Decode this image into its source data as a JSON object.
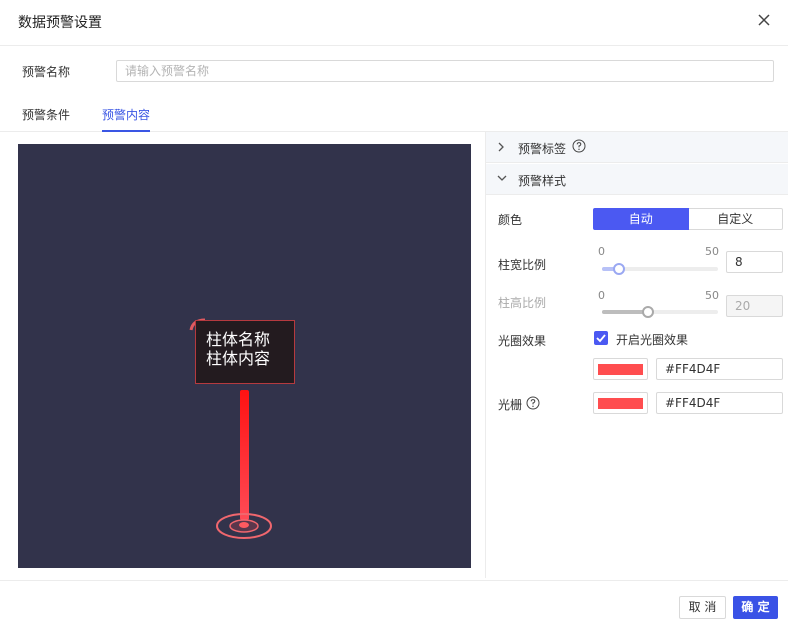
{
  "dialog": {
    "title": "数据预警设置",
    "close_icon": "close-icon"
  },
  "name_field": {
    "label": "预警名称",
    "placeholder": "请输入预警名称",
    "value": ""
  },
  "tabs": [
    {
      "label": "预警条件",
      "active": false
    },
    {
      "label": "预警内容",
      "active": true
    }
  ],
  "preview": {
    "background": "#32334B",
    "sign_lines": [
      "柱体名称",
      "柱体内容"
    ]
  },
  "settings": {
    "sections": [
      {
        "title": "预警标签",
        "expanded": false,
        "has_help": true
      },
      {
        "title": "预警样式",
        "expanded": true,
        "has_help": false
      }
    ],
    "color": {
      "label": "颜色",
      "options": [
        "自动",
        "自定义"
      ],
      "selected": "自动",
      "accent": "#4B59F2"
    },
    "column_width": {
      "label": "柱宽比例",
      "min": "0",
      "max": "50",
      "value": "8",
      "enabled": true
    },
    "column_height": {
      "label": "柱高比例",
      "min": "0",
      "max": "50",
      "value": "20",
      "enabled": false
    },
    "halo": {
      "label": "光圈效果",
      "checkbox_label": "开启光圈效果",
      "checked": true,
      "color": "#FF4D4F",
      "color_text": "#FF4D4F"
    },
    "grating": {
      "label": "光栅",
      "has_help": true,
      "color": "#FF4D4F",
      "color_text": "#FF4D4F"
    }
  },
  "footer": {
    "cancel_label": "取 消",
    "ok_label": "确 定"
  }
}
